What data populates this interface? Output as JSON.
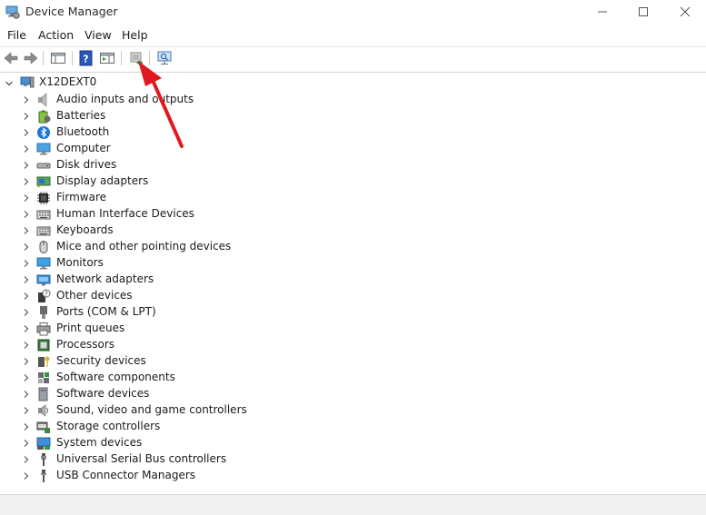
{
  "window": {
    "title": "Device Manager"
  },
  "menu": [
    "File",
    "Action",
    "View",
    "Help"
  ],
  "tree": {
    "root": "X12DEXT0",
    "items": [
      {
        "label": "Audio inputs and outputs",
        "icon": "speaker-icon"
      },
      {
        "label": "Batteries",
        "icon": "battery-icon"
      },
      {
        "label": "Bluetooth",
        "icon": "bluetooth-icon"
      },
      {
        "label": "Computer",
        "icon": "computer-icon"
      },
      {
        "label": "Disk drives",
        "icon": "disk-drive-icon"
      },
      {
        "label": "Display adapters",
        "icon": "display-adapter-icon"
      },
      {
        "label": "Firmware",
        "icon": "chip-icon"
      },
      {
        "label": "Human Interface Devices",
        "icon": "hid-keyboard-icon"
      },
      {
        "label": "Keyboards",
        "icon": "keyboard-icon"
      },
      {
        "label": "Mice and other pointing devices",
        "icon": "mouse-icon"
      },
      {
        "label": "Monitors",
        "icon": "monitor-icon"
      },
      {
        "label": "Network adapters",
        "icon": "network-icon"
      },
      {
        "label": "Other devices",
        "icon": "unknown-device-icon"
      },
      {
        "label": "Ports (COM & LPT)",
        "icon": "port-icon"
      },
      {
        "label": "Print queues",
        "icon": "printer-icon"
      },
      {
        "label": "Processors",
        "icon": "processor-icon"
      },
      {
        "label": "Security devices",
        "icon": "security-key-icon"
      },
      {
        "label": "Software components",
        "icon": "software-component-icon"
      },
      {
        "label": "Software devices",
        "icon": "software-device-icon"
      },
      {
        "label": "Sound, video and game controllers",
        "icon": "sound-icon"
      },
      {
        "label": "Storage controllers",
        "icon": "storage-controller-icon"
      },
      {
        "label": "System devices",
        "icon": "system-device-icon"
      },
      {
        "label": "Universal Serial Bus controllers",
        "icon": "usb-icon"
      },
      {
        "label": "USB Connector Managers",
        "icon": "usb-connector-icon"
      }
    ]
  },
  "colors": {
    "accent_blue": "#1e73d8",
    "annotation_arrow": "#e0191f"
  }
}
